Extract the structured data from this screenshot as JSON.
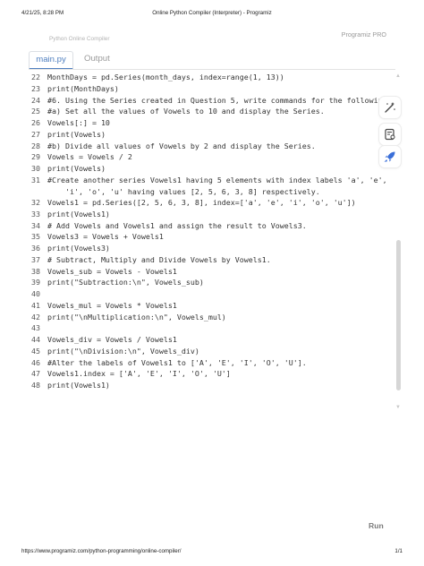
{
  "print_header": {
    "datetime": "4/21/25, 8:28 PM",
    "title": "Online Python Compiler (Interpreter) - Programiz"
  },
  "print_footer": {
    "url": "https://www.programiz.com/python-programming/online-compiler/",
    "page": "1/1"
  },
  "site": {
    "subtitle": "Python Online Compiler",
    "brand": "Programiz PRO"
  },
  "tabs": [
    {
      "label": "main.py",
      "active": true
    },
    {
      "label": "Output",
      "active": false
    }
  ],
  "code_lines": [
    {
      "n": "22",
      "t": "MonthDays = pd.Series(month_days, index=range(1, 13))"
    },
    {
      "n": "23",
      "t": "print(MonthDays)"
    },
    {
      "n": "24",
      "t": "#6. Using the Series created in Question 5, write commands for the following:"
    },
    {
      "n": "25",
      "t": "#a) Set all the values of Vowels to 10 and display the Series."
    },
    {
      "n": "26",
      "t": "Vowels[:] = 10"
    },
    {
      "n": "27",
      "t": "print(Vowels)"
    },
    {
      "n": "28",
      "t": "#b) Divide all values of Vowels by 2 and display the Series."
    },
    {
      "n": "29",
      "t": "Vowels = Vowels / 2"
    },
    {
      "n": "30",
      "t": "print(Vowels)"
    },
    {
      "n": "31",
      "t": "#Create another series Vowels1 having 5 elements with index labels 'a', 'e',"
    },
    {
      "n": "",
      "t": "    'i', 'o', 'u' having values [2, 5, 6, 3, 8] respectively."
    },
    {
      "n": "32",
      "t": "Vowels1 = pd.Series([2, 5, 6, 3, 8], index=['a', 'e', 'i', 'o', 'u'])"
    },
    {
      "n": "33",
      "t": "print(Vowels1)"
    },
    {
      "n": "34",
      "t": "# Add Vowels and Vowels1 and assign the result to Vowels3."
    },
    {
      "n": "35",
      "t": "Vowels3 = Vowels + Vowels1"
    },
    {
      "n": "36",
      "t": "print(Vowels3)"
    },
    {
      "n": "37",
      "t": "# Subtract, Multiply and Divide Vowels by Vowels1."
    },
    {
      "n": "38",
      "t": "Vowels_sub = Vowels - Vowels1"
    },
    {
      "n": "39",
      "t": "print(\"Subtraction:\\n\", Vowels_sub)"
    },
    {
      "n": "40",
      "t": ""
    },
    {
      "n": "41",
      "t": "Vowels_mul = Vowels * Vowels1"
    },
    {
      "n": "42",
      "t": "print(\"\\nMultiplication:\\n\", Vowels_mul)"
    },
    {
      "n": "43",
      "t": ""
    },
    {
      "n": "44",
      "t": "Vowels_div = Vowels / Vowels1"
    },
    {
      "n": "45",
      "t": "print(\"\\nDivision:\\n\", Vowels_div)"
    },
    {
      "n": "46",
      "t": "#Alter the labels of Vowels1 to ['A', 'E', 'I', 'O', 'U']."
    },
    {
      "n": "47",
      "t": "Vowels1.index = ['A', 'E', 'I', 'O', 'U']"
    },
    {
      "n": "48",
      "t": "print(Vowels1)"
    }
  ],
  "tools": [
    {
      "icon": "magic-wand-icon"
    },
    {
      "icon": "code-review-icon"
    },
    {
      "icon": "rocket-icon"
    }
  ],
  "run_label": "Run",
  "colors": {
    "accent": "#4f7fbf",
    "rocket": "#3b6fd8"
  }
}
